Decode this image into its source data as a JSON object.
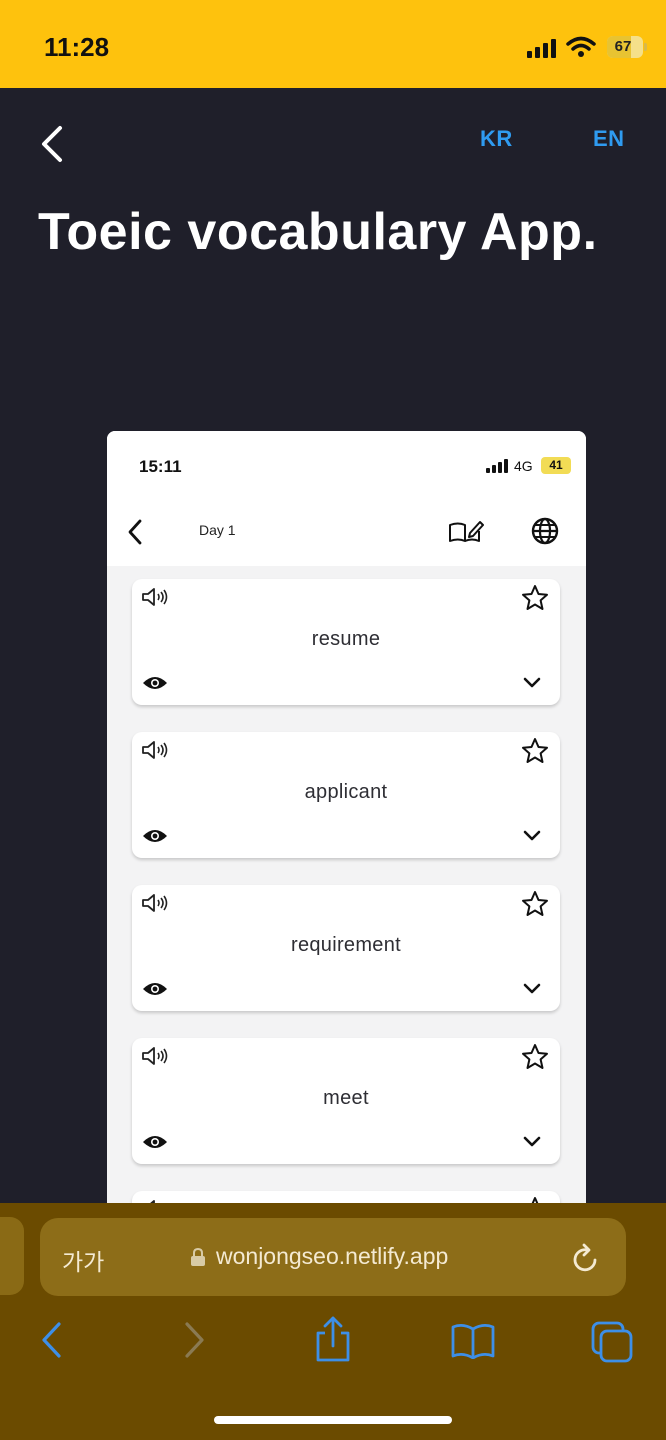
{
  "status_bar": {
    "time": "11:28",
    "battery": "67"
  },
  "header": {
    "lang_kr": "KR",
    "lang_en": "EN",
    "title": "Toeic vocabulary App."
  },
  "phone": {
    "time": "15:11",
    "network": "4G",
    "battery": "41",
    "day_label": "Day 1",
    "words": [
      "resume",
      "applicant",
      "requirement",
      "meet"
    ]
  },
  "safari": {
    "aa_label": "가가",
    "url": "wonjongseo.netlify.app"
  },
  "colors": {
    "status_bar": "#fec20d",
    "background": "#1f1f2a",
    "accent": "#2f9bf0",
    "safari_bar": "#6b4b00"
  }
}
